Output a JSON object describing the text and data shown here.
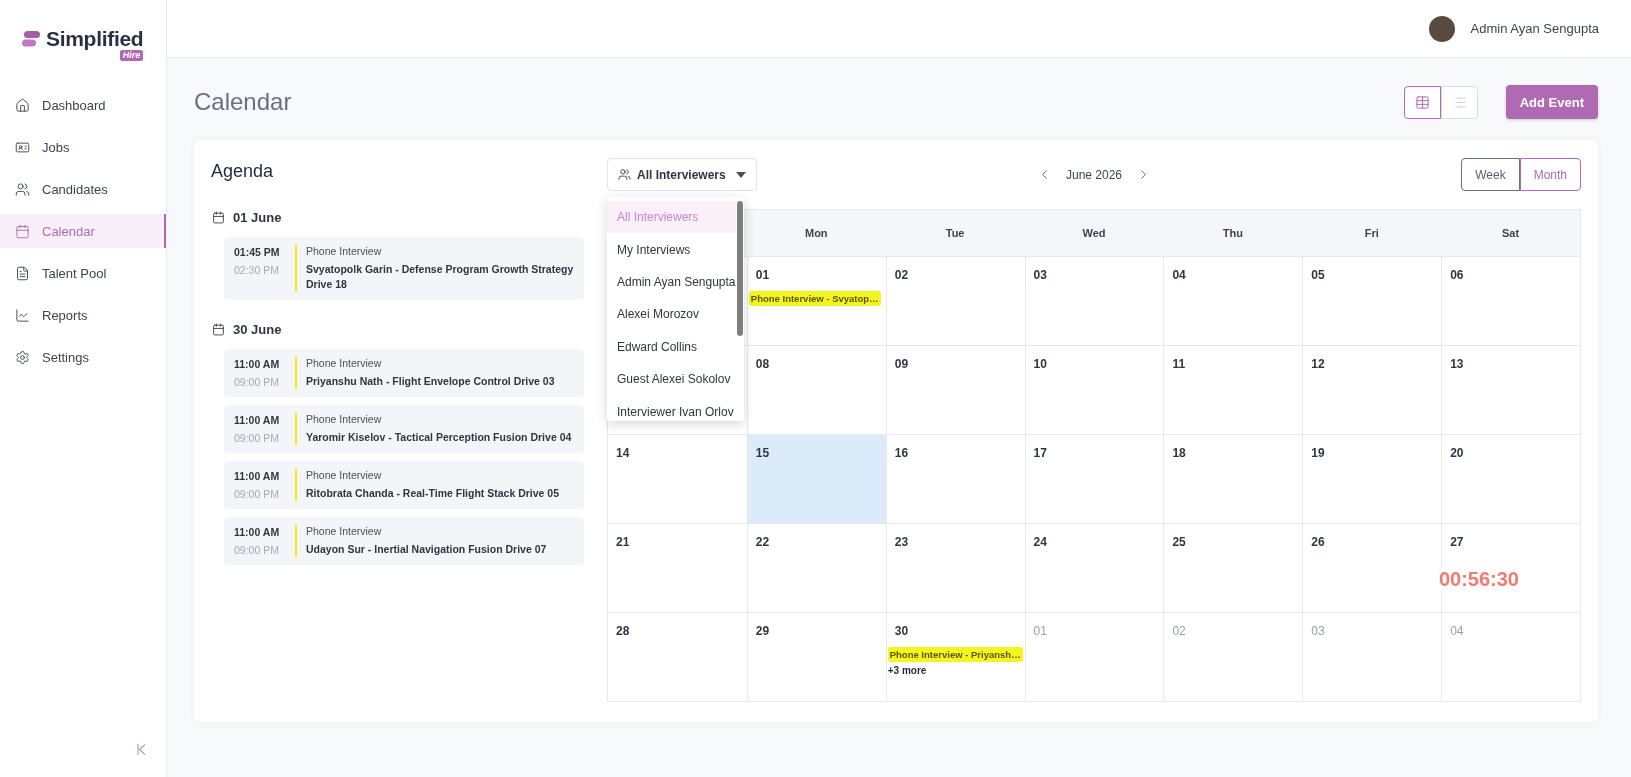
{
  "sidebar": {
    "logo": {
      "name": "Simplified",
      "badge": "Hire"
    },
    "items": [
      {
        "label": "Dashboard",
        "selected": false
      },
      {
        "label": "Jobs",
        "selected": false
      },
      {
        "label": "Candidates",
        "selected": false
      },
      {
        "label": "Calendar",
        "selected": true
      },
      {
        "label": "Talent Pool",
        "selected": false
      },
      {
        "label": "Reports",
        "selected": false
      },
      {
        "label": "Settings",
        "selected": false
      }
    ]
  },
  "header": {
    "user": "Admin Ayan Sengupta"
  },
  "page": {
    "title": "Calendar",
    "view_toggle": [
      {
        "kind": "grid",
        "selected": true
      },
      {
        "kind": "list",
        "selected": false
      }
    ],
    "add_button": "Add Event"
  },
  "agenda": {
    "title": "Agenda",
    "groups": [
      {
        "date": "01 June",
        "events": [
          {
            "start": "01:45 PM",
            "end": "02:30 PM",
            "type": "Phone Interview",
            "title": "Svyatopolk Garin - Defense Program Growth Strategy Drive 18"
          }
        ]
      },
      {
        "date": "30 June",
        "events": [
          {
            "start": "11:00 AM",
            "end": "09:00 PM",
            "type": "Phone Interview",
            "title": "Priyanshu Nath - Flight Envelope Control Drive 03"
          },
          {
            "start": "11:00 AM",
            "end": "09:00 PM",
            "type": "Phone Interview",
            "title": "Yaromir Kiselov - Tactical Perception Fusion Drive 04"
          },
          {
            "start": "11:00 AM",
            "end": "09:00 PM",
            "type": "Phone Interview",
            "title": "Ritobrata Chanda - Real-Time Flight Stack Drive 05"
          },
          {
            "start": "11:00 AM",
            "end": "09:00 PM",
            "type": "Phone Interview",
            "title": "Udayon Sur - Inertial Navigation Fusion Drive 07"
          }
        ]
      }
    ]
  },
  "filter": {
    "label": "All Interviewers",
    "options": [
      {
        "label": "All Interviewers",
        "selected": true
      },
      {
        "label": "My Interviews",
        "selected": false
      },
      {
        "label": "Admin Ayan Sengupta",
        "selected": false
      },
      {
        "label": "Alexei Morozov",
        "selected": false
      },
      {
        "label": "Edward Collins",
        "selected": false
      },
      {
        "label": "Guest Alexei Sokolov",
        "selected": false
      },
      {
        "label": "Interviewer Ivan Orlov",
        "selected": false
      }
    ]
  },
  "month": {
    "label": "June 2026"
  },
  "range": [
    {
      "label": "Week",
      "selected": false
    },
    {
      "label": "Month",
      "selected": true
    }
  ],
  "calendar": {
    "weekdays": [
      "Mon",
      "Tue",
      "Wed",
      "Thu",
      "Fri",
      "Sat"
    ],
    "weeks": [
      [
        {
          "date": "01",
          "outside": false,
          "today": false,
          "events": [
            "Phone Interview - Svyatop…"
          ]
        },
        {
          "date": "02",
          "outside": false,
          "today": false
        },
        {
          "date": "03",
          "outside": false,
          "today": false
        },
        {
          "date": "04",
          "outside": false,
          "today": false
        },
        {
          "date": "05",
          "outside": false,
          "today": false
        },
        {
          "date": "06",
          "outside": false,
          "today": false
        }
      ],
      [
        {
          "date": "08",
          "outside": false,
          "today": false
        },
        {
          "date": "09",
          "outside": false,
          "today": false
        },
        {
          "date": "10",
          "outside": false,
          "today": false
        },
        {
          "date": "11",
          "outside": false,
          "today": false
        },
        {
          "date": "12",
          "outside": false,
          "today": false
        },
        {
          "date": "13",
          "outside": false,
          "today": false
        }
      ],
      [
        {
          "date": "14",
          "outside": false,
          "today": false
        },
        {
          "date": "15",
          "outside": false,
          "today": true
        },
        {
          "date": "16",
          "outside": false,
          "today": false
        },
        {
          "date": "17",
          "outside": false,
          "today": false
        },
        {
          "date": "18",
          "outside": false,
          "today": false
        },
        {
          "date": "19",
          "outside": false,
          "today": false
        },
        {
          "date": "20",
          "outside": false,
          "today": false
        }
      ],
      [
        {
          "date": "21",
          "outside": false,
          "today": false
        },
        {
          "date": "22",
          "outside": false,
          "today": false
        },
        {
          "date": "23",
          "outside": false,
          "today": false
        },
        {
          "date": "24",
          "outside": false,
          "today": false
        },
        {
          "date": "25",
          "outside": false,
          "today": false
        },
        {
          "date": "26",
          "outside": false,
          "today": false
        },
        {
          "date": "27",
          "outside": false,
          "today": false
        }
      ],
      [
        {
          "date": "28",
          "outside": false,
          "today": false
        },
        {
          "date": "29",
          "outside": false,
          "today": false
        },
        {
          "date": "30",
          "outside": false,
          "today": false,
          "events": [
            "Phone Interview - Priyansh…"
          ],
          "more": "+3 more"
        },
        {
          "date": "01",
          "outside": true,
          "today": false
        },
        {
          "date": "02",
          "outside": true,
          "today": false
        },
        {
          "date": "03",
          "outside": true,
          "today": false
        },
        {
          "date": "04",
          "outside": true,
          "today": false
        }
      ]
    ]
  },
  "timer": "00:56:30"
}
